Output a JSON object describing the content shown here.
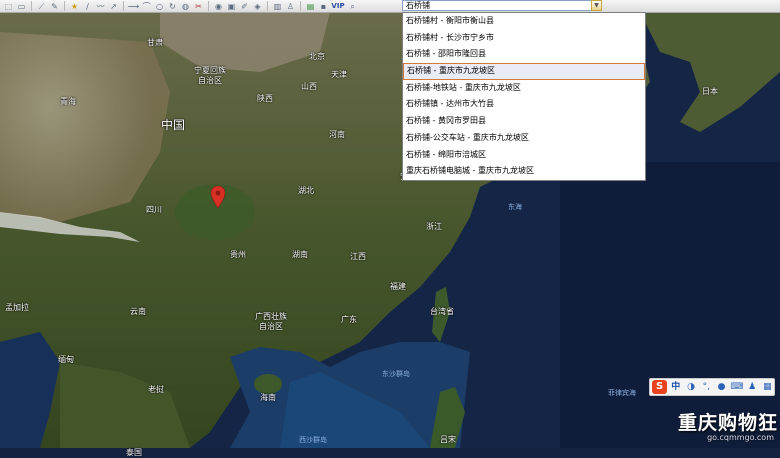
{
  "toolbar": {
    "icons": [
      "select-icon",
      "rect-select-icon",
      "ruler-icon",
      "pen-icon",
      "star-icon",
      "line-icon",
      "polyline-icon",
      "arrow-icon",
      "circle-icon",
      "rotate-icon",
      "paint-icon",
      "cut-icon",
      "globe-icon",
      "photo-icon",
      "eraser-icon",
      "layers-icon",
      "chart-icon",
      "person-icon",
      "window-icon",
      "vip-icon",
      "search-zoom-icon"
    ],
    "vip_label": "VIP",
    "search_value": "石桥铺"
  },
  "dropdown": {
    "selected_index": 3,
    "items": [
      "石桥铺村 - 衡阳市衡山县",
      "石桥铺村 - 长沙市宁乡市",
      "石桥铺 - 邵阳市隆回县",
      "石桥铺 - 重庆市九龙坡区",
      "石桥铺-地铁站 - 重庆市九龙坡区",
      "石桥铺镇 - 达州市大竹县",
      "石桥铺 - 黄冈市罗田县",
      "石桥铺-公交车站 - 重庆市九龙坡区",
      "石桥铺 - 绵阳市涪城区",
      "重庆石桥铺电脑城 - 重庆市九龙坡区"
    ]
  },
  "map_labels": {
    "beijing": "北京",
    "tianjin": "天津",
    "shanxi": "山西",
    "ningxia": "宁夏回族\n自治区",
    "gansu": "甘肃",
    "qinghai": "青海",
    "shaanxi": "陕西",
    "henan": "河南",
    "china": "中国",
    "sichuan": "四川",
    "hubei": "湖北",
    "anhui": "安徽",
    "zhejiang": "浙江",
    "guizhou": "贵州",
    "hunan": "湖南",
    "jiangxi": "江西",
    "fujian": "福建",
    "yunnan": "云南",
    "guangxi": "广西壮族\n自治区",
    "guangdong": "广东",
    "taiwan": "台湾省",
    "hainan": "海南",
    "myanmar": "缅甸",
    "laos": "老挝",
    "thailand": "泰国",
    "bangladesh": "孟加拉",
    "japan": "日本",
    "east_sea": "东海",
    "dongsha": "东沙群岛",
    "xisha": "西沙群岛",
    "philippine_sea": "菲律宾海",
    "lvsong": "吕宋"
  },
  "ime": {
    "logo": "S",
    "lang": "中"
  },
  "watermark": {
    "title": "重庆购物狂",
    "url": "go.cqmmgo.com"
  },
  "colors": {
    "land": "#4a5a2e",
    "ocean": "#14233f",
    "marker": "#d93025",
    "selection": "#d47a3c"
  }
}
